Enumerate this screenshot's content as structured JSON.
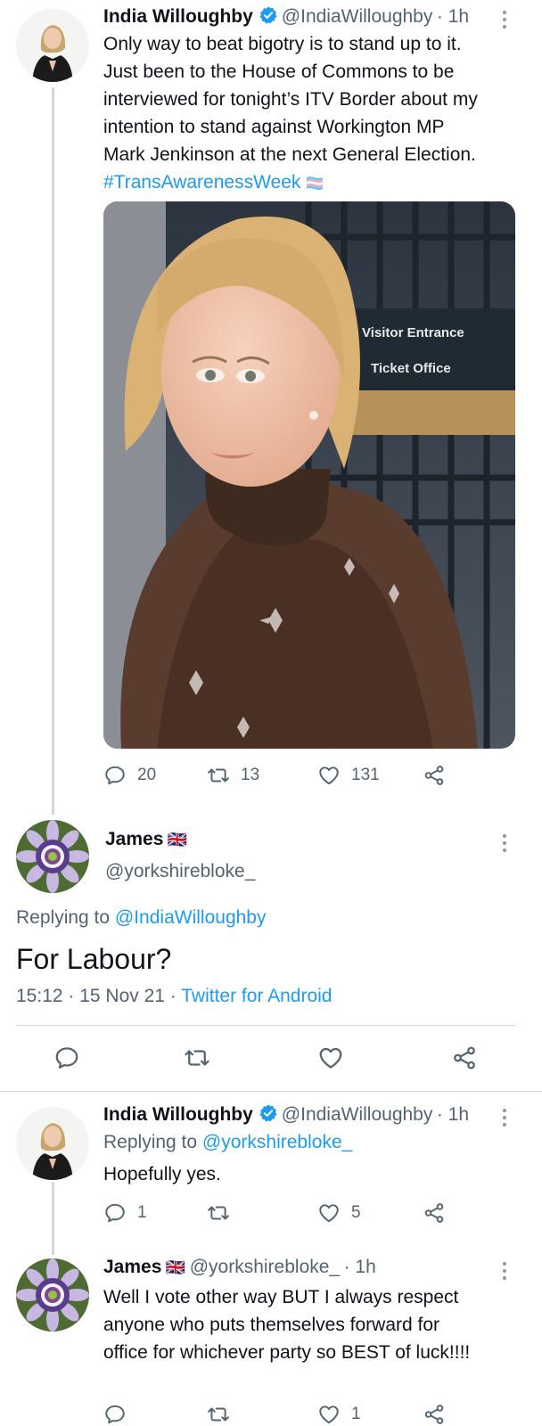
{
  "tweet1": {
    "name": "India Willoughby",
    "handle": "@IndiaWilloughby",
    "time": "· 1h",
    "text_lines": [
      "Only way to beat bigotry is to stand up to it.",
      "Just been to the House of Commons to be",
      "interviewed for tonight’s ITV Border about my",
      "intention to stand against Workington MP",
      "Mark Jenkinson at the next General Election."
    ],
    "hashtag": "#TransAwarenessWeek",
    "hashtag_emoji": "🏳️‍⚧️",
    "photo_sign": {
      "line1": "Visitor Entrance",
      "line2": "Ticket Office"
    },
    "replies": "20",
    "retweets": "13",
    "likes": "131"
  },
  "focused": {
    "name": "James",
    "flag": "🇬🇧",
    "handle": "@yorkshirebloke_",
    "replying_prefix": "Replying to",
    "replying_to": "@IndiaWilloughby",
    "text": "For Labour?",
    "datetime": "15:12 · 15 Nov 21 ·",
    "source": "Twitter for Android"
  },
  "reply1": {
    "name": "India Willoughby",
    "handle": "@IndiaWilloughby",
    "time": "· 1h",
    "replying_prefix": "Replying to",
    "replying_to": "@yorkshirebloke_",
    "text": "Hopefully yes.",
    "replies": "1",
    "likes": "5"
  },
  "reply2": {
    "name": "James",
    "flag": "🇬🇧",
    "handle": "@yorkshirebloke_",
    "time": "· 1h",
    "text_lines": [
      "Well I vote other way BUT I always respect",
      "anyone who puts themselves forward for",
      "office for whichever party so BEST of luck!!!!"
    ],
    "likes": "1"
  },
  "icons": {
    "reply": "reply-icon",
    "retweet": "retweet-icon",
    "like": "heart-icon",
    "share": "share-icon",
    "verified": "verified-badge-icon",
    "more": "more-options-icon"
  },
  "colors": {
    "link": "#1d9bf0",
    "secondary": "#536471",
    "verified": "#1d9bf0",
    "divider": "#cfd9de"
  }
}
